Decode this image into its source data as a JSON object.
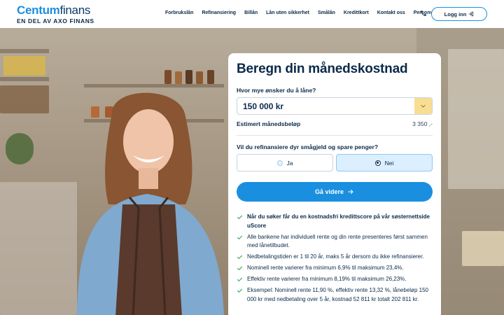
{
  "brand": {
    "logo_part1": "Centum",
    "logo_part2": "finans",
    "tagline": "EN DEL AV AXO FINANS"
  },
  "nav": {
    "items": [
      "Forbrukslån",
      "Refinansiering",
      "Billån",
      "Lån uten sikkerhet",
      "Smålån",
      "Kredittkort",
      "Kontakt oss",
      "Personvern"
    ],
    "login_label": "Logg inn"
  },
  "calculator": {
    "title": "Beregn din månedskostnad",
    "amount_question": "Hvor mye ønsker du å låne?",
    "amount_value": "150 000 kr",
    "estimate_label": "Estimert månedsbeløp",
    "estimate_value": "3 350 ,-",
    "refinance_question": "Vil du refinansiere dyr smågjeld og spare penger?",
    "options": [
      {
        "label": "Ja",
        "selected": false
      },
      {
        "label": "Nei",
        "selected": true
      }
    ],
    "cta_label": "Gå videre"
  },
  "bullets": [
    {
      "text": "Når du søker får du en kostnadsfri kredittscore på vår søsternettside uScore",
      "bold": true
    },
    {
      "text": "Alle bankene har individuell rente og din rente presenteres først sammen med lånetilbudet.",
      "bold": false
    },
    {
      "text": "Nedbetalingstiden er 1 til 20 år, maks 5 år dersom du ikke refinansierer.",
      "bold": false
    },
    {
      "text": "Nominell rente varierer fra minimum 6,9% til maksimum 23,4%.",
      "bold": false
    },
    {
      "text": "Effektiv rente varierer fra minimum 8,19% til maksimum 26,23%.",
      "bold": false
    },
    {
      "text": "Eksempel: Nominell rente 11,90 %, effektiv rente 13,32 %, lånebeløp 150 000 kr med nedbetaling over 5 år, kostnad 52 811 kr totalt 202 811 kr.",
      "bold": false
    }
  ],
  "colors": {
    "accent": "#1a8fe0",
    "navy": "#0b2a4a",
    "dropdown": "#f8dd93",
    "check": "#3aa655",
    "selected_option": "#dcefff"
  }
}
